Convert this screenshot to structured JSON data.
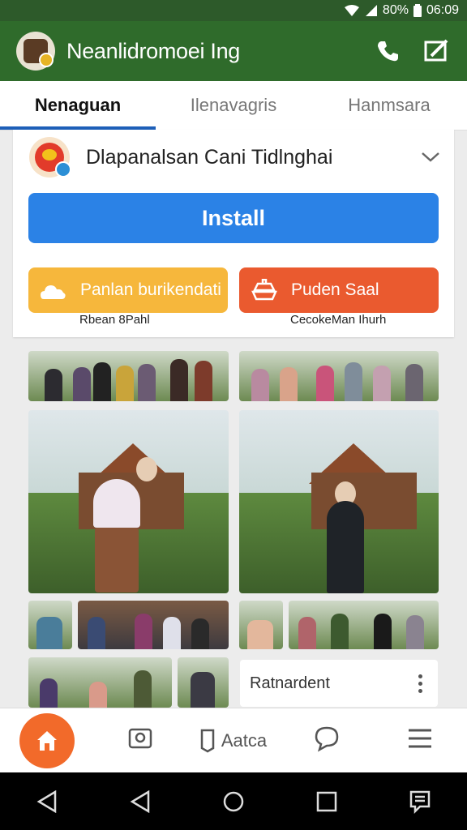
{
  "status_bar": {
    "battery_percent": "80%",
    "time": "06:09",
    "icons": [
      "wifi-icon",
      "cell-signal-icon",
      "battery-icon"
    ]
  },
  "app_bar": {
    "title": "Neanlidromoei Ing",
    "actions": [
      "phone-icon",
      "compose-icon"
    ],
    "color": "#2f6b2b"
  },
  "tabs": [
    {
      "label": "Nenaguan",
      "active": true
    },
    {
      "label": "Ilenavagris",
      "active": false
    },
    {
      "label": "Hanmsara",
      "active": false
    }
  ],
  "app_card": {
    "app_name": "Dlapanalsan Cani Tidlnghai",
    "install_label": "Install",
    "install_color": "#2b82e6",
    "actions": [
      {
        "label": "Panlan burikendati",
        "sublabel": "Rbean 8Pahl",
        "color": "#f6b73c",
        "icon": "cloud-icon"
      },
      {
        "label": "Puden Saal",
        "sublabel": "CecokeMan Ihurh",
        "color": "#ea5a2f",
        "icon": "ship-icon"
      }
    ]
  },
  "gallery": {
    "note_card_label": "Ratnardent"
  },
  "bottom_nav": {
    "items": [
      {
        "icon": "home-icon",
        "label": "",
        "active": true
      },
      {
        "icon": "profile-icon",
        "label": ""
      },
      {
        "icon": "bookmark-icon",
        "label": "Aatca"
      },
      {
        "icon": "chat-icon",
        "label": ""
      },
      {
        "icon": "menu-icon",
        "label": ""
      }
    ],
    "active_color": "#f26a2a"
  },
  "system_nav": [
    "back-icon",
    "back-icon",
    "home-circle-icon",
    "recents-icon",
    "notes-icon"
  ]
}
